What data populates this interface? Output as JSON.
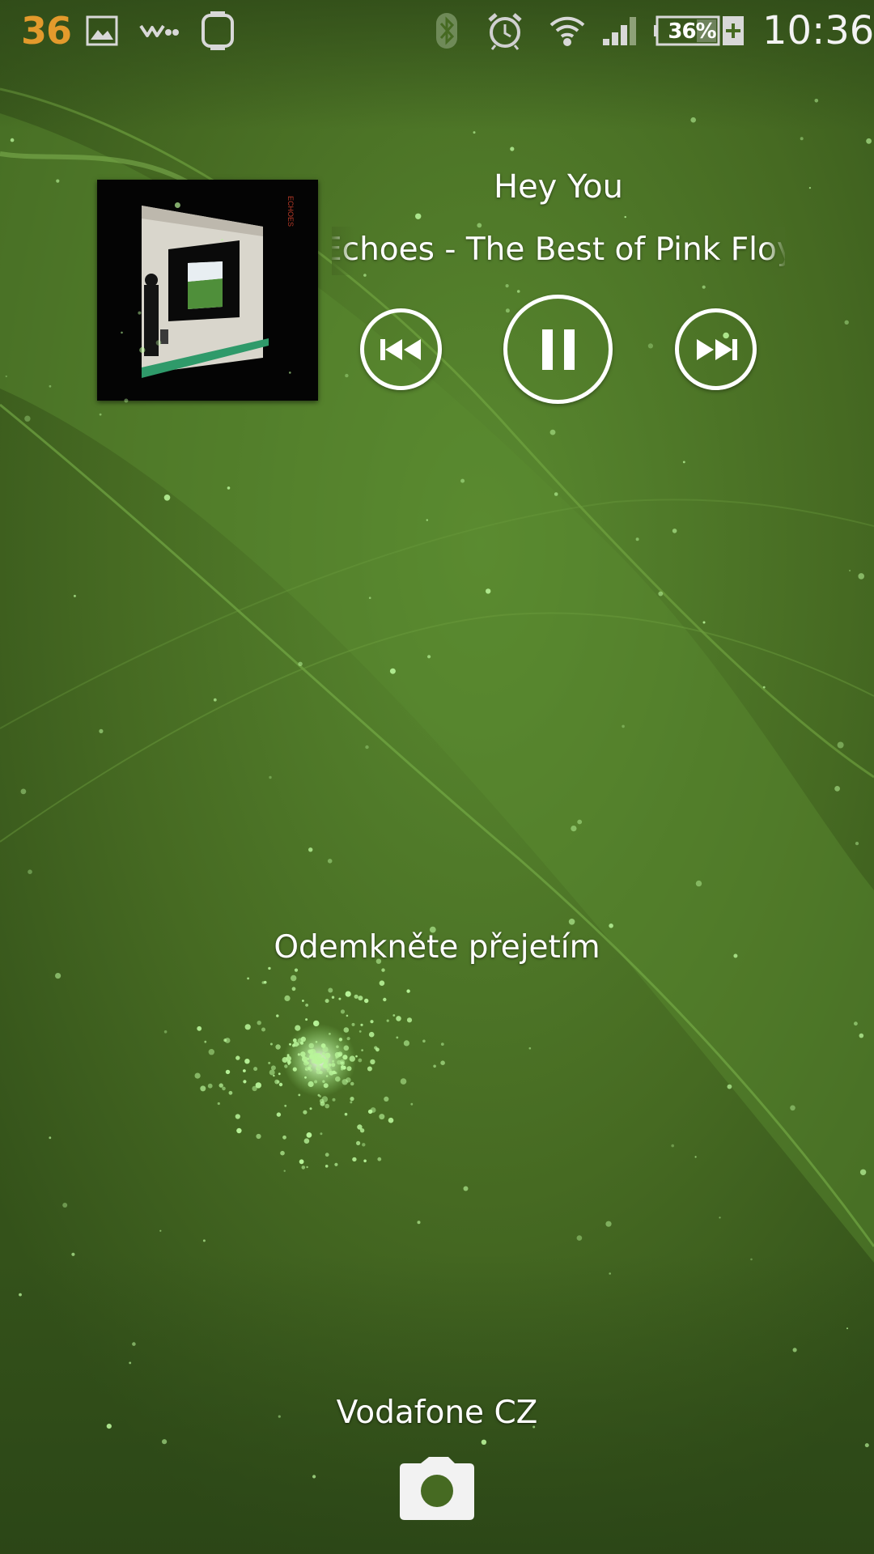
{
  "status_bar": {
    "notification_count": "36",
    "battery_percent": "36%",
    "time": "10:36",
    "icons": [
      "gallery-icon",
      "walkman-icon",
      "smartwatch-icon",
      "bluetooth-icon",
      "alarm-icon",
      "wifi-icon",
      "signal-icon",
      "battery-icon",
      "charging-icon"
    ]
  },
  "music": {
    "track_title": "Hey You",
    "album": "Echoes - The Best of Pink Floyd",
    "controls": [
      "previous-track",
      "pause",
      "next-track"
    ]
  },
  "lockscreen": {
    "unlock_hint": "Odemkněte přejetím",
    "carrier": "Vodafone CZ"
  },
  "colors": {
    "wallpaper": "#466a22",
    "notification_accent": "#e39a2c",
    "sparkle": "#b9f59a"
  }
}
